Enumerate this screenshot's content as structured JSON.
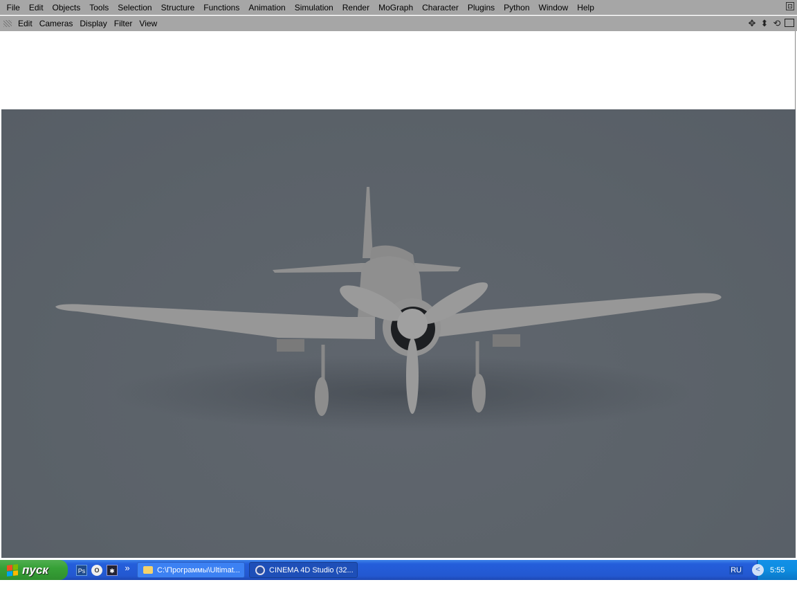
{
  "menubar": {
    "items": [
      "File",
      "Edit",
      "Objects",
      "Tools",
      "Selection",
      "Structure",
      "Functions",
      "Animation",
      "Simulation",
      "Render",
      "MoGraph",
      "Character",
      "Plugins",
      "Python",
      "Window",
      "Help"
    ]
  },
  "viewport_menu": {
    "items": [
      "Edit",
      "Cameras",
      "Display",
      "Filter",
      "View"
    ]
  },
  "taskbar": {
    "start": "пуск",
    "quicklaunch": [
      "Ps",
      "Opera",
      "Cinema 4D"
    ],
    "more": "»",
    "tasks": [
      "C:\\Программы\\Ultimat...",
      "CINEMA 4D Studio (32..."
    ],
    "lang": "RU",
    "clock": "5:55"
  },
  "colors": {
    "render_bg": "#5b6269",
    "plane": "#9a9a9a",
    "menubar": "#a6a6a6"
  }
}
